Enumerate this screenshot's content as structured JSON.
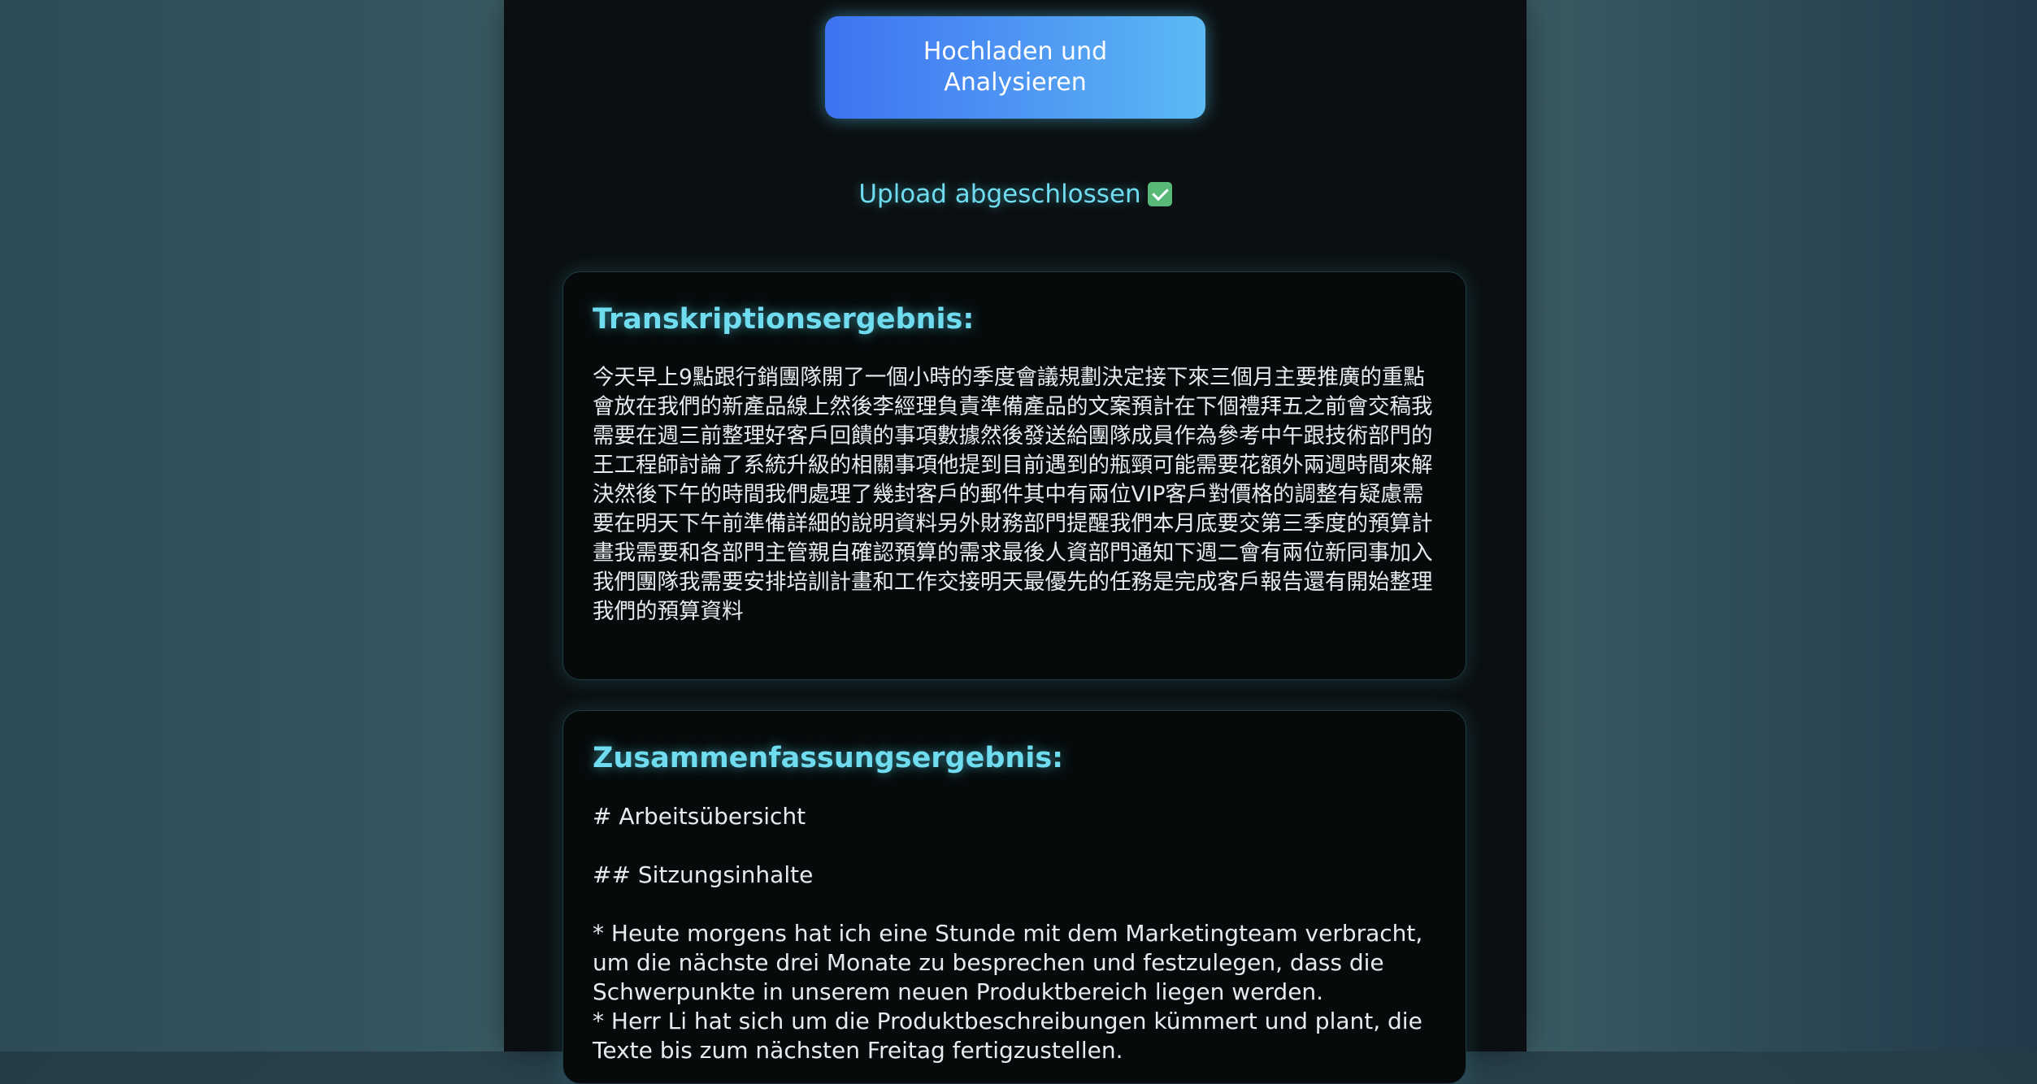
{
  "upload_button": {
    "label": "Hochladen und Analysieren"
  },
  "status": {
    "text": "Upload abgeschlossen"
  },
  "transcription": {
    "title": "Transkriptionsergebnis:",
    "text": "今天早上9點跟行銷團隊開了一個小時的季度會議規劃決定接下來三個月主要推廣的重點會放在我們的新產品線上然後李經理負責準備產品的文案預計在下個禮拜五之前會交稿我需要在週三前整理好客戶回饋的事項數據然後發送給團隊成員作為參考中午跟技術部門的王工程師討論了系統升級的相關事項他提到目前遇到的瓶頸可能需要花額外兩週時間來解決然後下午的時間我們處理了幾封客戶的郵件其中有兩位VIP客戶對價格的調整有疑慮需要在明天下午前準備詳細的說明資料另外財務部門提醒我們本月底要交第三季度的預算計畫我需要和各部門主管親自確認預算的需求最後人資部門通知下週二會有兩位新同事加入我們團隊我需要安排培訓計畫和工作交接明天最優先的任務是完成客戶報告還有開始整理我們的預算資料"
  },
  "summary": {
    "title": "Zusammenfassungsergebnis:",
    "heading1": "# Arbeitsübersicht",
    "heading2": "## Sitzungsinhalte",
    "bullet1": "* Heute morgens hat ich eine Stunde mit dem Marketingteam verbracht, um die nächste drei Monate zu besprechen und festzulegen, dass die Schwerpunkte in unserem neuen Produktbereich liegen werden.",
    "bullet2": "* Herr Li hat sich um die Produktbeschreibungen kümmert und plant, die Texte bis zum nächsten Freitag fertigzustellen."
  }
}
